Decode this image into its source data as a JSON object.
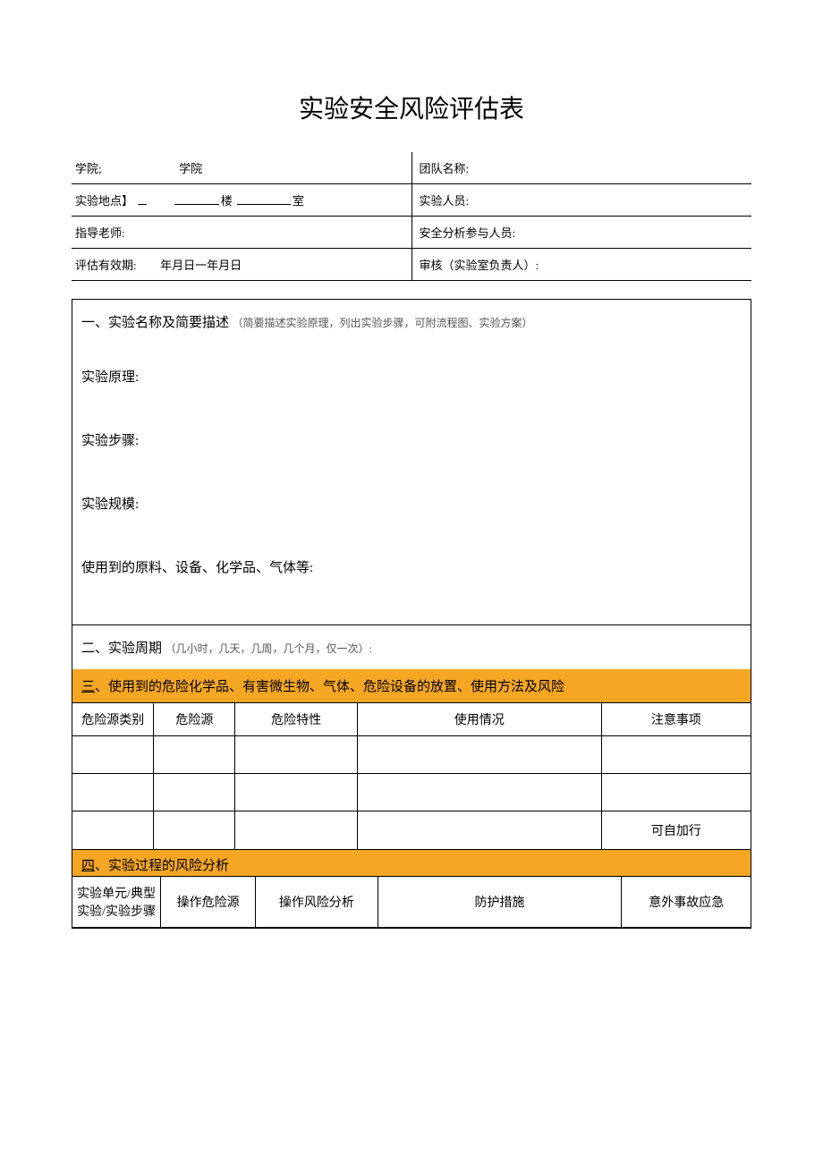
{
  "title": "实验安全风险评估表",
  "info": {
    "college_label": "学院;",
    "college_value": "学院",
    "team_label": "团队名称:",
    "location_label": "实验地点】",
    "building_suffix": "楼",
    "room_suffix": "室",
    "personnel_label": "实验人员:",
    "instructor_label": "指导老师:",
    "safety_personnel_label": "安全分析参与人员:",
    "validity_label": "评估有效期:",
    "validity_value": "年月日一年月日",
    "auditor_label": "审核（实验室负责人）:"
  },
  "section1": {
    "header": "一、实验名称及简要描述",
    "note": "（简要描述实验原理，列出实验步骤，可附流程图、实验方案）",
    "field_principle": "实验原理:",
    "field_steps": "实验步骤:",
    "field_scale": "实验规模:",
    "field_materials": "使用到的原料、设备、化学品、气体等:"
  },
  "section2": {
    "header": "二、实验周期",
    "note": "（几小时，几天，几周，几个月，仅一次）:"
  },
  "section3": {
    "header_prefix": "三",
    "header_text": "、使用到的危险化学品、有害微生物、气体、危险设备的放置、使用方法及风险",
    "columns": [
      "危险源类别",
      "危险源",
      "危险特性",
      "使用情况",
      "注意事项"
    ],
    "rows": [
      [
        "",
        "",
        "",
        "",
        ""
      ],
      [
        "",
        "",
        "",
        "",
        ""
      ],
      [
        "",
        "",
        "",
        "",
        "可自加行"
      ]
    ]
  },
  "section4": {
    "header_prefix": "四",
    "header_text": "、实验过程的风险分析",
    "columns": [
      "实验单元/典型实验/实验步骤",
      "操作危险源",
      "操作风险分析",
      "防护措施",
      "意外事故应急"
    ]
  }
}
